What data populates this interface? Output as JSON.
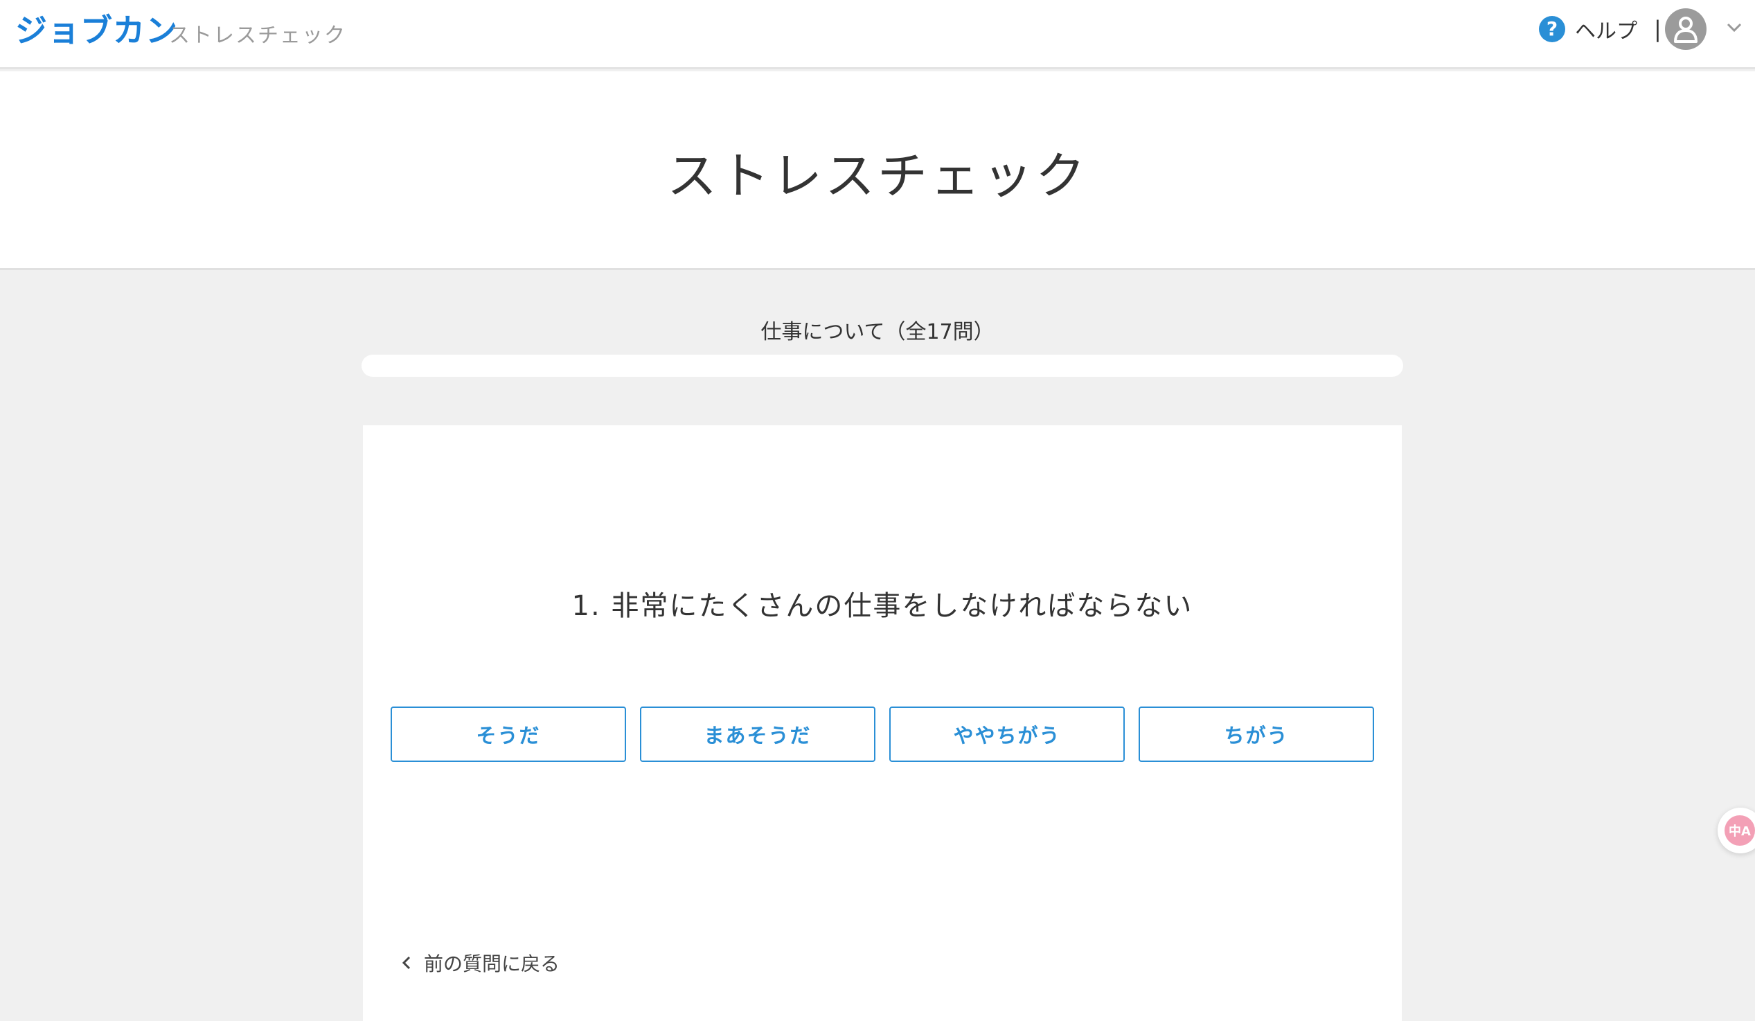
{
  "header": {
    "logo": "ジョブカン",
    "product": "ストレスチェック",
    "help_label": "ヘルプ",
    "help_icon": "?",
    "divider": "|"
  },
  "title": "ストレスチェック",
  "section": {
    "label": "仕事について（全17問）",
    "progress": 0
  },
  "question": {
    "text": "1. 非常にたくさんの仕事をしなければならない",
    "options": [
      "そうだ",
      "まあそうだ",
      "ややちがう",
      "ちがう"
    ]
  },
  "back_label": "前の質問に戻る",
  "translate_widget": "中A",
  "colors": {
    "accent": "#2a8fd6",
    "logo": "#1a7fd8",
    "background": "#f0f0f0"
  }
}
